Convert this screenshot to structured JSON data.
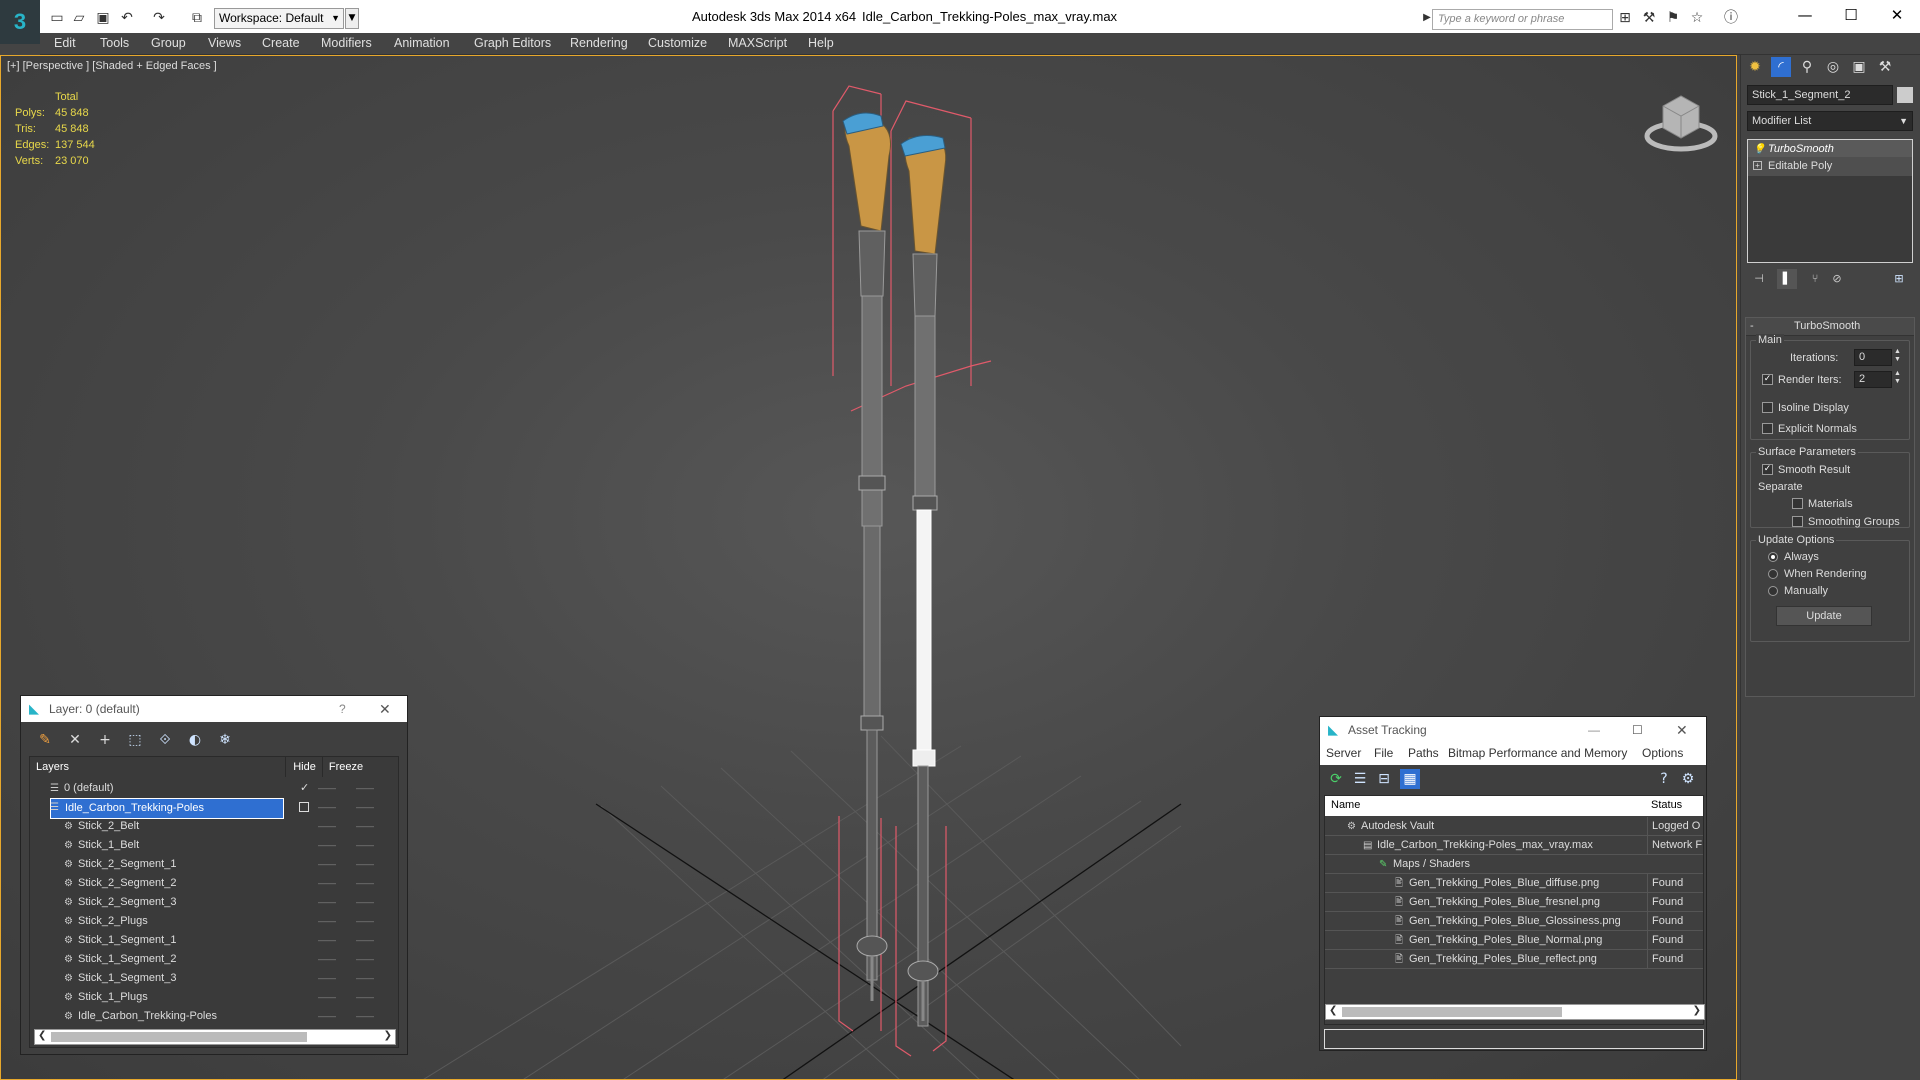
{
  "window": {
    "app_title": "Autodesk 3ds Max  2014 x64",
    "file_title": "Idle_Carbon_Trekking-Poles_max_vray.max",
    "workspace": "Workspace: Default",
    "search_placeholder": "Type a keyword or phrase"
  },
  "menu": [
    "Edit",
    "Tools",
    "Group",
    "Views",
    "Create",
    "Modifiers",
    "Animation",
    "Graph Editors",
    "Rendering",
    "Customize",
    "MAXScript",
    "Help"
  ],
  "viewport": {
    "label": "[+] [Perspective ] [Shaded + Edged Faces ]",
    "stats": {
      "header": "Total",
      "rows": [
        {
          "label": "Polys:",
          "value": "45 848"
        },
        {
          "label": "Tris:",
          "value": "45 848"
        },
        {
          "label": "Edges:",
          "value": "137 544"
        },
        {
          "label": "Verts:",
          "value": "23 070"
        }
      ]
    }
  },
  "command_panel": {
    "object_name": "Stick_1_Segment_2",
    "modifier_list": "Modifier List",
    "stack": [
      "TurboSmooth",
      "Editable Poly"
    ],
    "turbosmooth": {
      "title": "TurboSmooth",
      "main": "Main",
      "iterations_label": "Iterations:",
      "iterations": "0",
      "render_iters_label": "Render Iters:",
      "render_iters": "2",
      "isoline": "Isoline Display",
      "explicit_normals": "Explicit Normals",
      "surface_params": "Surface Parameters",
      "smooth_result": "Smooth Result",
      "separate": "Separate",
      "materials": "Materials",
      "smoothing_groups": "Smoothing Groups",
      "update_options": "Update Options",
      "always": "Always",
      "when_rendering": "When Rendering",
      "manually": "Manually",
      "update": "Update"
    }
  },
  "layer_dialog": {
    "title": "Layer: 0 (default)",
    "help": "?",
    "columns": {
      "layers": "Layers",
      "hide": "Hide",
      "freeze": "Freeze"
    },
    "layers": [
      {
        "name": "0 (default)",
        "level": 0
      },
      {
        "name": "Idle_Carbon_Trekking-Poles",
        "level": 0
      },
      {
        "name": "Stick_2_Belt",
        "level": 1
      },
      {
        "name": "Stick_1_Belt",
        "level": 1
      },
      {
        "name": "Stick_2_Segment_1",
        "level": 1
      },
      {
        "name": "Stick_2_Segment_2",
        "level": 1
      },
      {
        "name": "Stick_2_Segment_3",
        "level": 1
      },
      {
        "name": "Stick_2_Plugs",
        "level": 1
      },
      {
        "name": "Stick_1_Segment_1",
        "level": 1
      },
      {
        "name": "Stick_1_Segment_2",
        "level": 1
      },
      {
        "name": "Stick_1_Segment_3",
        "level": 1
      },
      {
        "name": "Stick_1_Plugs",
        "level": 1
      },
      {
        "name": "Idle_Carbon_Trekking-Poles",
        "level": 1
      }
    ],
    "dash": "——"
  },
  "asset_dialog": {
    "title": "Asset Tracking",
    "menu": [
      "Server",
      "File",
      "Paths",
      "Bitmap Performance and Memory",
      "Options"
    ],
    "columns": {
      "name": "Name",
      "status": "Status"
    },
    "rows": [
      {
        "name": "Autodesk Vault",
        "status": "Logged O",
        "indent": 1
      },
      {
        "name": "Idle_Carbon_Trekking-Poles_max_vray.max",
        "status": "Network F",
        "indent": 2
      },
      {
        "name": "Maps / Shaders",
        "status": "",
        "indent": 3
      },
      {
        "name": "Gen_Trekking_Poles_Blue_diffuse.png",
        "status": "Found",
        "indent": 4
      },
      {
        "name": "Gen_Trekking_Poles_Blue_fresnel.png",
        "status": "Found",
        "indent": 4
      },
      {
        "name": "Gen_Trekking_Poles_Blue_Glossiness.png",
        "status": "Found",
        "indent": 4
      },
      {
        "name": "Gen_Trekking_Poles_Blue_Normal.png",
        "status": "Found",
        "indent": 4
      },
      {
        "name": "Gen_Trekking_Poles_Blue_reflect.png",
        "status": "Found",
        "indent": 4
      }
    ]
  },
  "colors": {
    "accent_border": "#e7a82c",
    "selection": "#2f6fd1",
    "stats": "#e8d84a",
    "bbox": "#e05a6a"
  }
}
